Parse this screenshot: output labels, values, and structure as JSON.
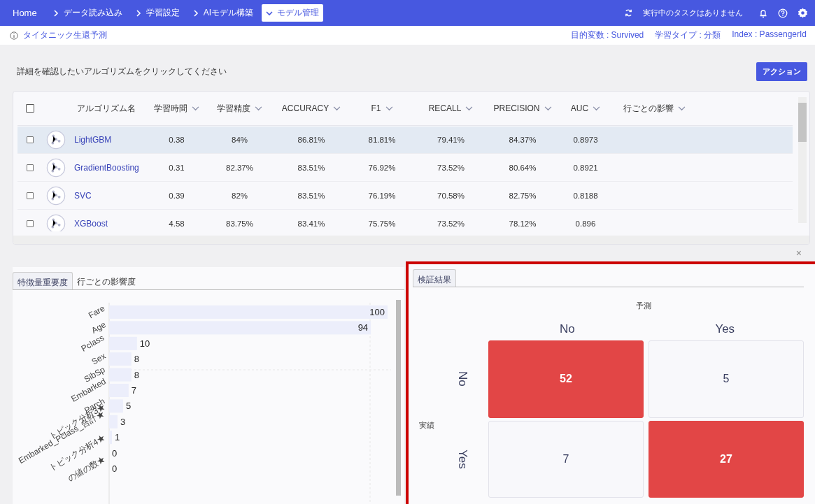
{
  "nav": {
    "breadcrumbs": [
      {
        "label": "Home",
        "selected": false
      },
      {
        "label": "データ読み込み",
        "selected": false
      },
      {
        "label": "学習設定",
        "selected": false
      },
      {
        "label": "AIモデル構築",
        "selected": false
      },
      {
        "label": "モデル管理",
        "selected": true
      }
    ],
    "task_status": "実行中のタスクはありません"
  },
  "project": {
    "title": "タイタニック生還予測",
    "meta": [
      "目的変数 : Survived",
      "学習タイプ : 分類",
      "Index : PassengerId"
    ]
  },
  "instruction": "詳細を確認したいアルゴリズムをクリックしてください",
  "action_button": "アクション",
  "table": {
    "select_all_checked": false,
    "columns": [
      "アルゴリズム名",
      "学習時間",
      "学習精度",
      "ACCURACY",
      "F1",
      "RECALL",
      "PRECISION",
      "AUC",
      "行ごとの影響"
    ],
    "rows": [
      {
        "name": "LightGBM",
        "checked": false,
        "selected": true,
        "values": [
          "0.38",
          "84%",
          "86.81%",
          "81.81%",
          "79.41%",
          "84.37%",
          "0.8973"
        ]
      },
      {
        "name": "GradientBoosting",
        "checked": false,
        "selected": false,
        "values": [
          "0.31",
          "82.37%",
          "83.51%",
          "76.92%",
          "73.52%",
          "80.64%",
          "0.8921"
        ]
      },
      {
        "name": "SVC",
        "checked": false,
        "selected": false,
        "values": [
          "0.39",
          "82%",
          "83.51%",
          "76.19%",
          "70.58%",
          "82.75%",
          "0.8188"
        ]
      },
      {
        "name": "XGBoost",
        "checked": false,
        "selected": false,
        "values": [
          "4.58",
          "83.75%",
          "83.41%",
          "75.75%",
          "73.52%",
          "78.12%",
          "0.896"
        ]
      }
    ]
  },
  "close_symbol": "×",
  "feature_panel": {
    "tabs": [
      {
        "label": "特徴量重要度",
        "selected": true
      },
      {
        "label": "行ごとの影響度",
        "selected": false
      }
    ],
    "chart_data": {
      "type": "bar",
      "orientation": "horizontal",
      "data_labels": true,
      "categories": [
        "Fare",
        "Age",
        "Pclass",
        "Sex",
        "SibSp",
        "Embarked",
        "Parch",
        "トピック分析3★",
        "Embarked_Pclass_合計★",
        "トピック分析4★",
        "の値の数★"
      ],
      "values": [
        100,
        94,
        10,
        8,
        8,
        7,
        5,
        3,
        1,
        0,
        0
      ]
    }
  },
  "validation_panel": {
    "tabs": [
      {
        "label": "検証結果",
        "selected": true
      }
    ],
    "predicted_label": "予測",
    "actual_label": "実績",
    "columns": [
      "No",
      "Yes"
    ],
    "rows": [
      {
        "label": "No",
        "cells": [
          {
            "value": "52",
            "highlighted": true
          },
          {
            "value": "5",
            "highlighted": false
          }
        ]
      },
      {
        "label": "Yes",
        "cells": [
          {
            "value": "7",
            "highlighted": false
          },
          {
            "value": "27",
            "highlighted": true
          }
        ]
      }
    ]
  }
}
